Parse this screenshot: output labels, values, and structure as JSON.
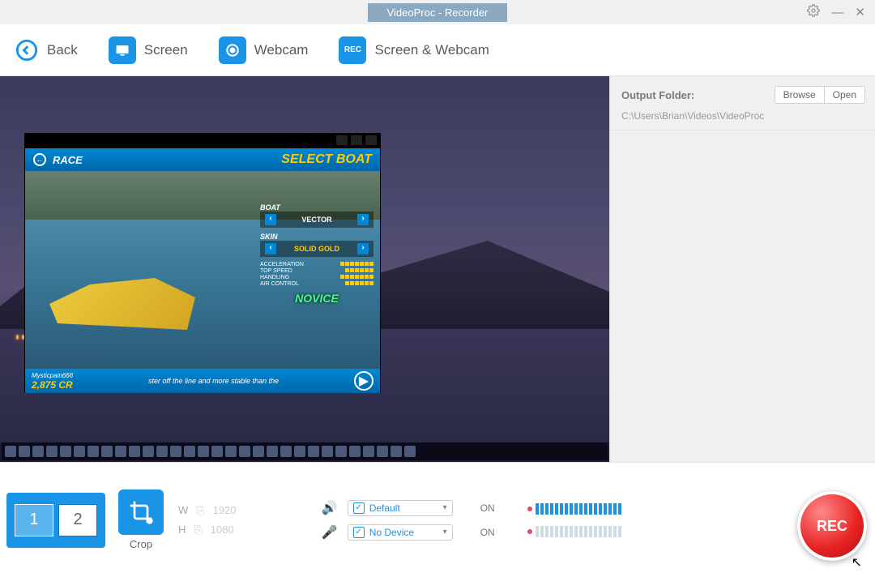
{
  "window": {
    "title": "VideoProc - Recorder"
  },
  "toolbar": {
    "back": "Back",
    "screen": "Screen",
    "webcam": "Webcam",
    "screen_webcam": "Screen & Webcam"
  },
  "sidepanel": {
    "output_folder_label": "Output Folder:",
    "browse": "Browse",
    "open": "Open",
    "path": "C:\\Users\\Brian\\Videos\\VideoProc"
  },
  "game_preview": {
    "race_label": "RACE",
    "select_boat": "SELECT BOAT",
    "boat_label": "BOAT",
    "boat_value": "VECTOR",
    "skin_label": "SKIN",
    "skin_value": "SOLID GOLD",
    "stats": {
      "acceleration": "ACCELERATION",
      "top_speed": "TOP SPEED",
      "handling": "HANDLING",
      "air_control": "AIR CONTROL"
    },
    "difficulty": "NOVICE",
    "username": "Mysticpain666",
    "credits": "2,875 CR",
    "ticker": "ster off the line and more stable than the"
  },
  "controls": {
    "monitor_1": "1",
    "monitor_2": "2",
    "crop": "Crop",
    "w_label": "W",
    "h_label": "H",
    "w_value": "1920",
    "h_value": "1080",
    "audio_device": "Default",
    "mic_device": "No Device",
    "audio_on": "ON",
    "mic_on": "ON",
    "rec": "REC"
  }
}
